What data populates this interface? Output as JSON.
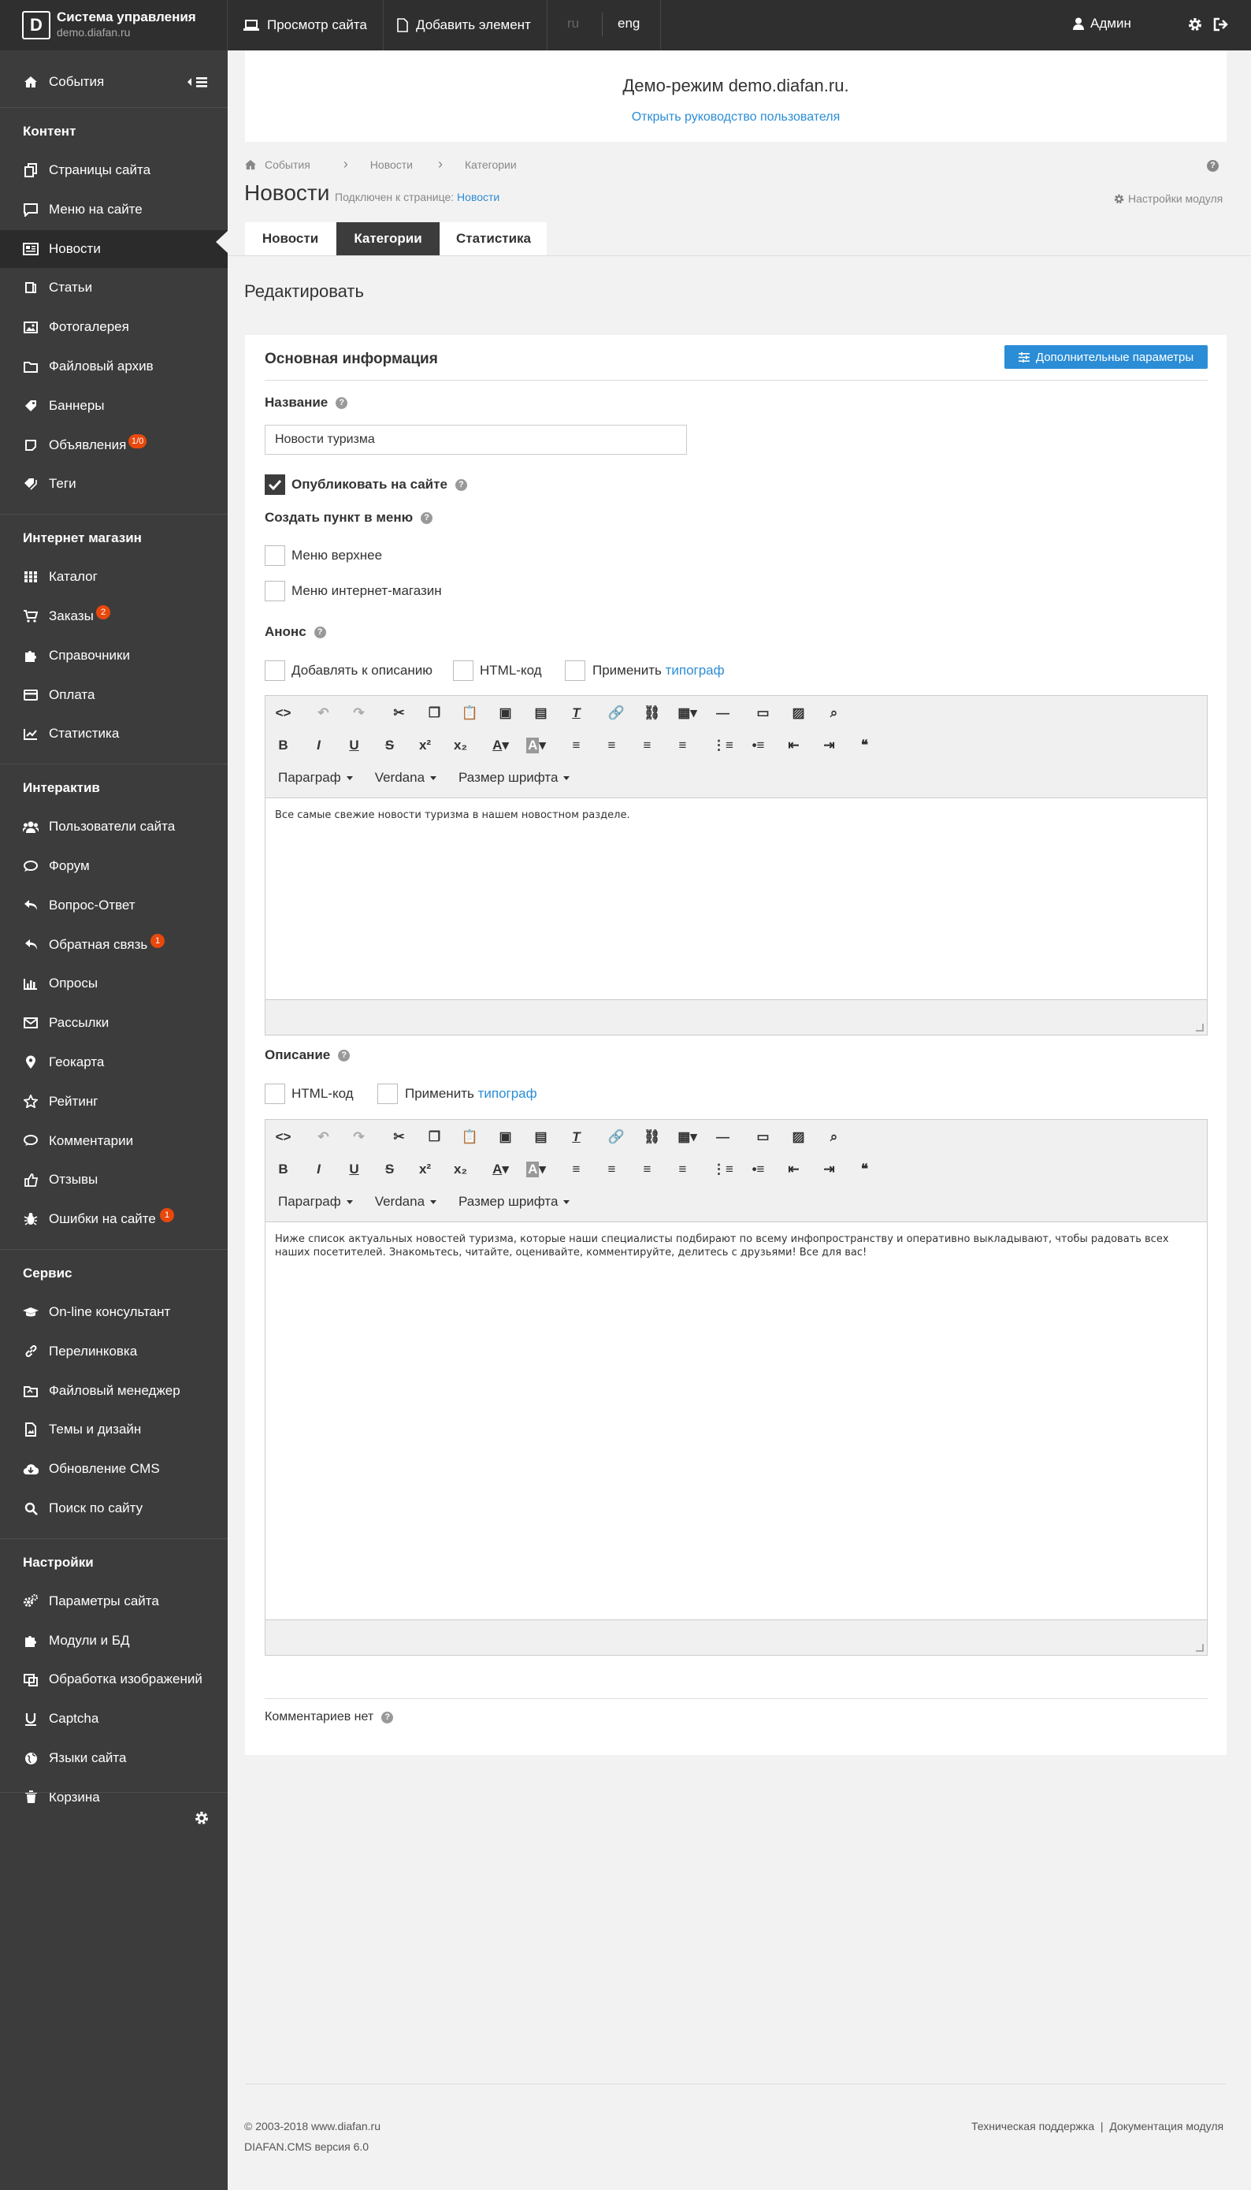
{
  "topbar": {
    "logo_mark": "D",
    "title": "Система управления",
    "subtitle": "demo.diafan.ru",
    "view_site": "Просмотр сайта",
    "add_element": "Добавить элемент",
    "lang_ru": "ru",
    "lang_eng": "eng",
    "user": "Админ"
  },
  "sidebar": {
    "events": "События",
    "sections": [
      {
        "title": "Контент",
        "items": [
          {
            "label": "Страницы сайта",
            "icon": "pages-icon"
          },
          {
            "label": "Меню на сайте",
            "icon": "menu-icon"
          },
          {
            "label": "Новости",
            "icon": "news-icon",
            "active": true
          },
          {
            "label": "Статьи",
            "icon": "article-icon"
          },
          {
            "label": "Фотогалерея",
            "icon": "photo-icon"
          },
          {
            "label": "Файловый архив",
            "icon": "folder-icon"
          },
          {
            "label": "Баннеры",
            "icon": "banner-icon"
          },
          {
            "label": "Объявления",
            "icon": "ads-icon",
            "badge": "1/0"
          },
          {
            "label": "Теги",
            "icon": "tags-icon"
          }
        ]
      },
      {
        "title": "Интернет магазин",
        "items": [
          {
            "label": "Каталог",
            "icon": "catalog-icon"
          },
          {
            "label": "Заказы",
            "icon": "cart-icon",
            "badge": "2"
          },
          {
            "label": "Справочники",
            "icon": "puzzle-icon"
          },
          {
            "label": "Оплата",
            "icon": "credit-card-icon"
          },
          {
            "label": "Статистика",
            "icon": "chart-icon"
          }
        ]
      },
      {
        "title": "Интерактив",
        "items": [
          {
            "label": "Пользователи сайта",
            "icon": "users-icon"
          },
          {
            "label": "Форум",
            "icon": "forum-icon"
          },
          {
            "label": "Вопрос-Ответ",
            "icon": "reply-icon"
          },
          {
            "label": "Обратная связь",
            "icon": "reply-all-icon",
            "badge": "1"
          },
          {
            "label": "Опросы",
            "icon": "poll-icon"
          },
          {
            "label": "Рассылки",
            "icon": "envelope-icon"
          },
          {
            "label": "Геокарта",
            "icon": "map-marker-icon"
          },
          {
            "label": "Рейтинг",
            "icon": "star-icon"
          },
          {
            "label": "Комментарии",
            "icon": "comment-icon"
          },
          {
            "label": "Отзывы",
            "icon": "thumbs-up-icon"
          },
          {
            "label": "Ошибки на сайте",
            "icon": "bug-icon",
            "badge": "1"
          }
        ]
      },
      {
        "title": "Сервис",
        "items": [
          {
            "label": "On-line консультант",
            "icon": "graduation-cap-icon"
          },
          {
            "label": "Перелинковка",
            "icon": "link-icon"
          },
          {
            "label": "Файловый менеджер",
            "icon": "file-manager-icon"
          },
          {
            "label": "Темы и дизайн",
            "icon": "theme-icon"
          },
          {
            "label": "Обновление CMS",
            "icon": "cloud-download-icon"
          },
          {
            "label": "Поиск по сайту",
            "icon": "search-icon"
          }
        ]
      },
      {
        "title": "Настройки",
        "items": [
          {
            "label": "Параметры сайта",
            "icon": "gears-icon"
          },
          {
            "label": "Модули и БД",
            "icon": "puzzle-icon"
          },
          {
            "label": "Обработка изображений",
            "icon": "crop-icon"
          },
          {
            "label": "Captcha",
            "icon": "underline-icon"
          },
          {
            "label": "Языки сайта",
            "icon": "globe-icon"
          },
          {
            "label": "Корзина",
            "icon": "trash-icon"
          }
        ]
      }
    ]
  },
  "demo": {
    "title": "Демо-режим demo.diafan.ru.",
    "link": "Открыть руководство пользователя"
  },
  "breadcrumb": [
    "События",
    "Новости",
    "Категории"
  ],
  "page": {
    "title": "Новости",
    "connected_label": "Подключен к странице:",
    "connected_link": "Новости",
    "module_settings": "Настройки модуля",
    "tabs": [
      "Новости",
      "Категории",
      "Статистика"
    ],
    "active_tab": "Категории",
    "edit_title": "Редактировать"
  },
  "form": {
    "section_title": "Основная информация",
    "adv_button": "Дополнительные параметры",
    "name_label": "Название",
    "name_value": "Новости туризма",
    "publish_label": "Опубликовать на сайте",
    "publish_checked": true,
    "menu_label": "Создать пункт в меню",
    "menu_top": "Меню верхнее",
    "menu_shop": "Меню интернет-магазин",
    "anons_label": "Анонс",
    "add_to_desc": "Добавлять к описанию",
    "html_code": "HTML-код",
    "apply": "Применить",
    "typograf": "типограф",
    "desc_label": "Описание",
    "anons_text": "Все самые свежие новости туризма в нашем новостном разделе.",
    "desc_text": "Ниже список актуальных новостей туризма, которые наши специалисты подбирают по всему инфопространству и оперативно выкладывают, чтобы радовать всех наших посетителей. Знакомьтесь, читайте, оценивайте, комментируйте, делитесь с друзьями! Все для вас!",
    "no_comments": "Комментариев нет"
  },
  "editor": {
    "paragraph": "Параграф",
    "font": "Verdana",
    "font_size": "Размер шрифта"
  },
  "footer": {
    "copyright": "© 2003-2018 www.diafan.ru",
    "version": "DIAFAN.CMS версия 6.0",
    "support": "Техническая поддержка",
    "sep": "|",
    "docs": "Документация модуля"
  },
  "colors": {
    "accent": "#2b8dd6",
    "sidebar": "#3c3c3c",
    "topbar": "#2f2f2f",
    "badge": "#e8480c"
  }
}
